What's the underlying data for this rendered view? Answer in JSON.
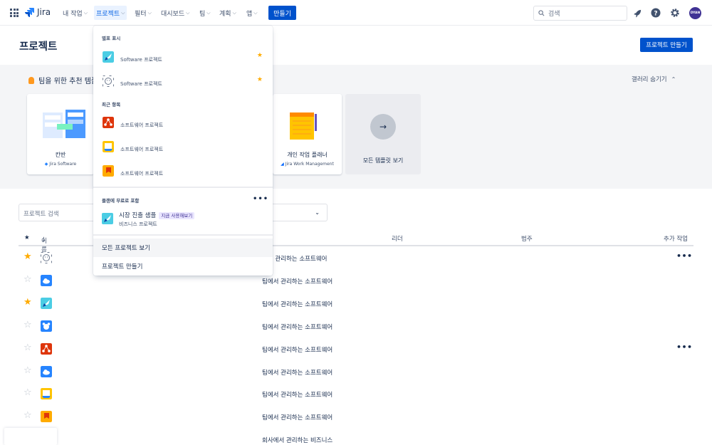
{
  "colors": {
    "brand": "#0052CC",
    "star": "#FFAB00",
    "nav_active_bg": "#E9F2FF"
  },
  "nav": {
    "logo": "Jira",
    "items": [
      {
        "label": "내 작업"
      },
      {
        "label": "프로젝트"
      },
      {
        "label": "필터"
      },
      {
        "label": "대시보드"
      },
      {
        "label": "팀"
      },
      {
        "label": "계획"
      },
      {
        "label": "앱"
      }
    ],
    "create_label": "만들기",
    "search_placeholder": "검색",
    "avatar_initials": "DYAN"
  },
  "page": {
    "title": "프로젝트",
    "create_project_label": "프로젝트 만들기"
  },
  "templates": {
    "heading": "팀을 위한 추천 템플",
    "gallery_toggle": "갤러리 숨기기",
    "cards": [
      {
        "name": "칸반",
        "product": "Jira Software"
      },
      {
        "name": "개인 작업 플래너",
        "product": "Jira Work Management"
      }
    ],
    "all_label": "모든 템플릿 보기"
  },
  "filter": {
    "search_placeholder": "프로젝트 검색"
  },
  "table": {
    "headers": {
      "name": "이름",
      "lead": "리더",
      "category": "범주",
      "actions": "추가 작업"
    },
    "rows": [
      {
        "starred": true,
        "icon": "face-icon",
        "type": "에서 관리하는 소프트웨어",
        "more": true
      },
      {
        "starred": false,
        "icon": "cloud-icon",
        "type": "팀에서 관리하는 소프트웨어",
        "more": false
      },
      {
        "starred": true,
        "icon": "rocket-icon",
        "type": "팀에서 관리하는 소프트웨어",
        "more": false
      },
      {
        "starred": false,
        "icon": "bear-icon",
        "type": "팀에서 관리하는 소프트웨어",
        "more": false
      },
      {
        "starred": false,
        "icon": "network-icon",
        "type": "팀에서 관리하는 소프트웨어",
        "more": true
      },
      {
        "starred": false,
        "icon": "cloud-icon",
        "type": "팀에서 관리하는 소프트웨어",
        "more": false
      },
      {
        "starred": false,
        "icon": "boat-icon",
        "type": "팀에서 관리하는 소프트웨어",
        "more": false
      },
      {
        "starred": false,
        "icon": "flag-icon",
        "type": "팀에서 관리하는 소프트웨어",
        "more": false
      },
      {
        "starred": false,
        "icon": "",
        "type": "회사에서 관리하는 비즈니스",
        "more": false
      }
    ]
  },
  "dropdown": {
    "starred_heading": "별표 표시",
    "starred": [
      {
        "label": "Software 프로젝트",
        "icon": "rocket-icon"
      },
      {
        "label": "Software 프로젝트",
        "icon": "face-icon"
      }
    ],
    "recent_heading": "최근 항목",
    "recent": [
      {
        "label": "소프트웨어 프로젝트",
        "icon": "network-icon"
      },
      {
        "label": "소프트웨어 프로젝트",
        "icon": "boat-icon"
      },
      {
        "label": "소프트웨어 프로젝트",
        "icon": "flag-icon"
      }
    ],
    "plan_heading": "플랜에 무료로 포함",
    "plan_item": {
      "title": "시장 진출 샘플",
      "badge": "지금 사용해보기",
      "subtitle": "비즈니스 프로젝트"
    },
    "view_all": "모든 프로젝트 보기",
    "create": "프로젝트 만들기"
  }
}
